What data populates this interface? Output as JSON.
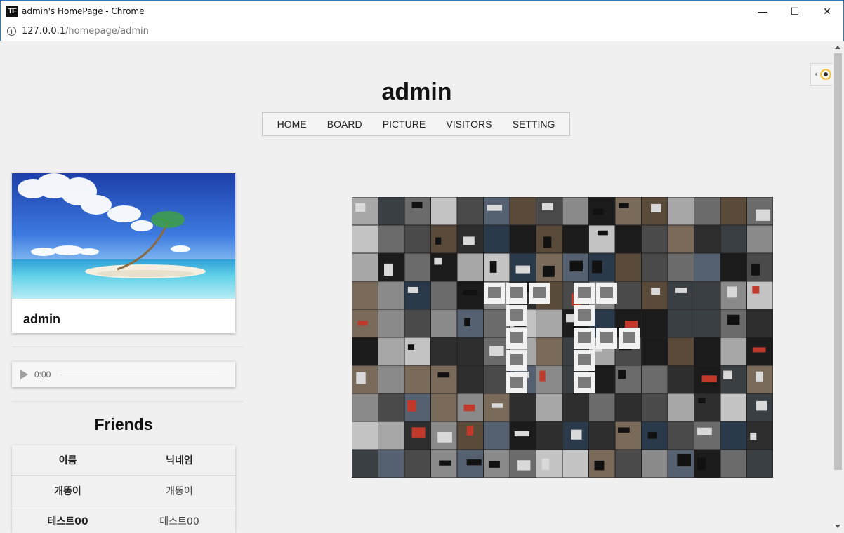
{
  "window": {
    "title": "admin's HomePage - Chrome",
    "app_icon_text": "TF",
    "minimize_glyph": "—",
    "maximize_glyph": "☐",
    "close_glyph": "✕"
  },
  "address": {
    "host": "127.0.0.1",
    "path": "/homepage/admin"
  },
  "page": {
    "title": "admin",
    "nav": [
      "HOME",
      "BOARD",
      "PICTURE",
      "VISITORS",
      "SETTING"
    ]
  },
  "profile": {
    "name": "admin"
  },
  "audio": {
    "time": "0:00"
  },
  "friends": {
    "title": "Friends",
    "headers": [
      "이름",
      "닉네임"
    ],
    "rows": [
      {
        "name": "개똥이",
        "nickname": "개똥이"
      },
      {
        "name": "테스트00",
        "nickname": "테스트00"
      }
    ]
  },
  "colors": {
    "window_border": "#2b78c2",
    "page_bg": "#f0f0f0"
  }
}
